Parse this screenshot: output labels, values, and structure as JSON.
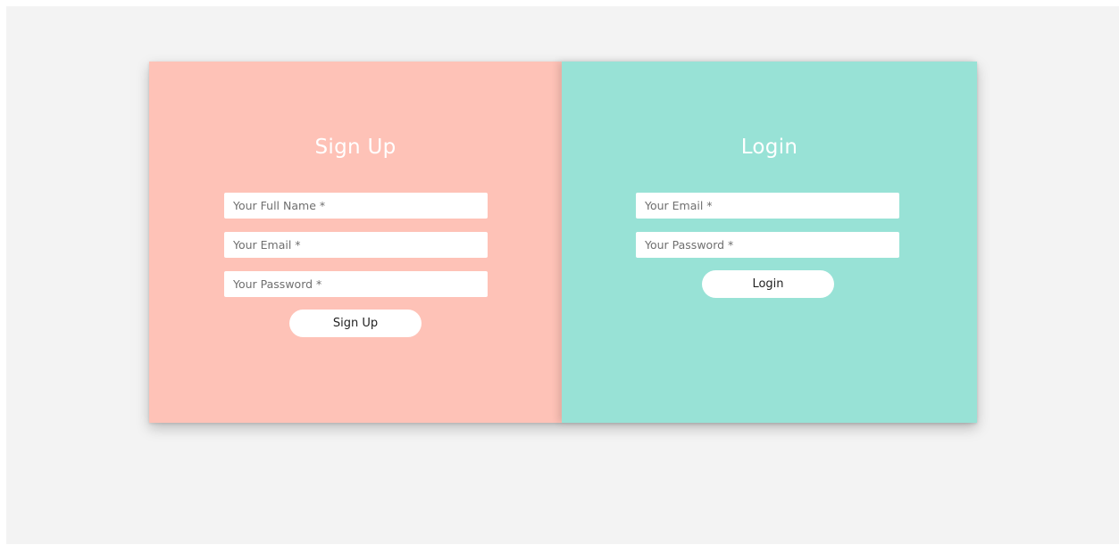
{
  "signup": {
    "title": "Sign Up",
    "full_name_placeholder": "Your Full Name *",
    "email_placeholder": "Your Email *",
    "password_placeholder": "Your Password *",
    "button_label": "Sign Up",
    "background_color": "#fec2b7"
  },
  "login": {
    "title": "Login",
    "email_placeholder": "Your Email *",
    "password_placeholder": "Your Password *",
    "button_label": "Login",
    "background_color": "#98e2d6"
  }
}
